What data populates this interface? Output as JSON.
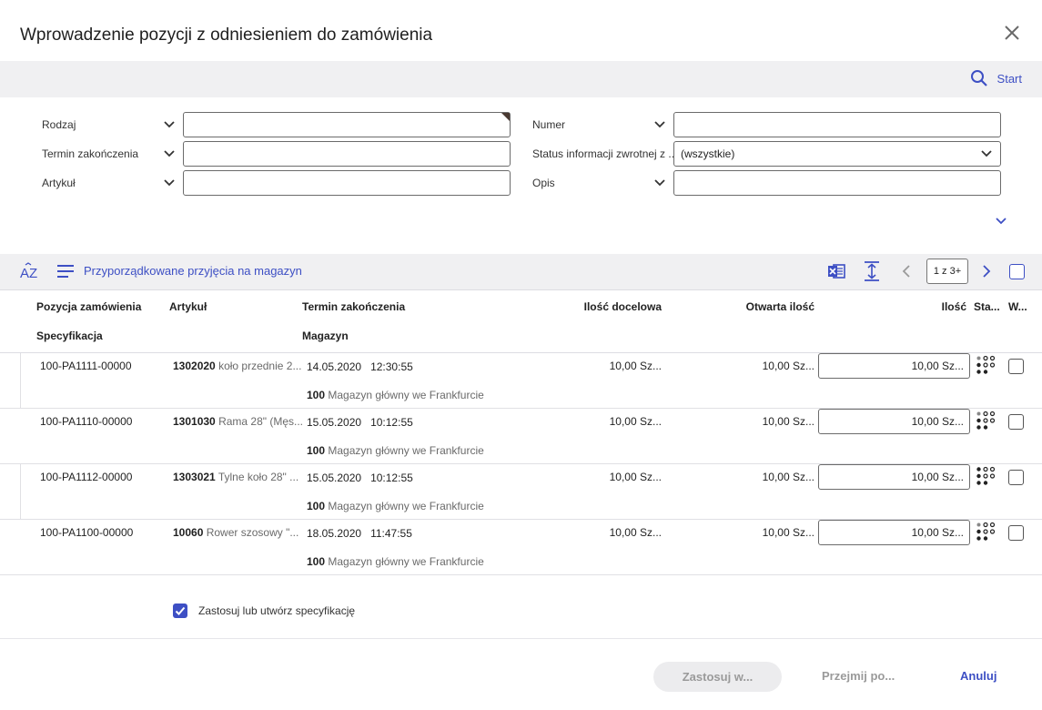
{
  "dialog": {
    "title": "Wprowadzenie pozycji z odniesieniem do zamówienia"
  },
  "search_bar": {
    "start_label": "Start"
  },
  "filters": {
    "rodzaj": {
      "label": "Rodzaj",
      "value": ""
    },
    "termin": {
      "label": "Termin zakończenia",
      "value": ""
    },
    "artykul": {
      "label": "Artykuł",
      "value": ""
    },
    "numer": {
      "label": "Numer",
      "value": ""
    },
    "status": {
      "label": "Status informacji zwrotnej z ...",
      "value": "(wszystkie)"
    },
    "opis": {
      "label": "Opis",
      "value": ""
    }
  },
  "toolbar": {
    "title": "Przyporządkowane przyjęcia na magazyn",
    "page_indicator": "1 z 3+"
  },
  "table": {
    "headers": {
      "pozycja": "Pozycja zamówienia",
      "artykul": "Artykuł",
      "termin": "Termin zakończenia",
      "ilosc_docelowa": "Ilość docelowa",
      "otwarta_ilosc": "Otwarta ilość",
      "ilosc": "Ilość",
      "status": "Sta...",
      "w": "W...",
      "specyfikacja": "Specyfikacja",
      "magazyn": "Magazyn"
    },
    "rows": [
      {
        "pozycja": "100-PA1111-00000",
        "art_code": "1302020",
        "art_name": "koło przednie 2...",
        "date": "14.05.2020",
        "time": "12:30:55",
        "mag_code": "100",
        "mag_name": "Magazyn główny we Frankfurcie",
        "ilosc_docelowa": "10,00 Sz...",
        "otwarta": "10,00 Sz...",
        "ilosc": "10,00 Sz..."
      },
      {
        "pozycja": "100-PA1110-00000",
        "art_code": "1301030",
        "art_name": "Rama 28\" (Męs...",
        "date": "15.05.2020",
        "time": "10:12:55",
        "mag_code": "100",
        "mag_name": "Magazyn główny we Frankfurcie",
        "ilosc_docelowa": "10,00 Sz...",
        "otwarta": "10,00 Sz...",
        "ilosc": "10,00 Sz..."
      },
      {
        "pozycja": "100-PA1112-00000",
        "art_code": "1303021",
        "art_name": "Tylne koło 28\" ...",
        "date": "15.05.2020",
        "time": "10:12:55",
        "mag_code": "100",
        "mag_name": "Magazyn główny we Frankfurcie",
        "ilosc_docelowa": "10,00 Sz...",
        "otwarta": "10,00 Sz...",
        "ilosc": "10,00 Sz..."
      },
      {
        "pozycja": "100-PA1100-00000",
        "art_code": "10060",
        "art_name": "Rower szosowy \"...",
        "date": "18.05.2020",
        "time": "11:47:55",
        "mag_code": "100",
        "mag_name": "Magazyn główny we Frankfurcie",
        "ilosc_docelowa": "10,00 Sz...",
        "otwarta": "10,00 Sz...",
        "ilosc": "10,00 Sz..."
      }
    ]
  },
  "options": {
    "spec_label": "Zastosuj lub utwórz specyfikację",
    "spec_checked": true
  },
  "footer": {
    "apply_label": "Zastosuj w...",
    "take_label": "Przejmij po...",
    "cancel_label": "Anuluj"
  },
  "colors": {
    "accent": "#3d4fc4",
    "bar_bg": "#f0f0f2"
  }
}
